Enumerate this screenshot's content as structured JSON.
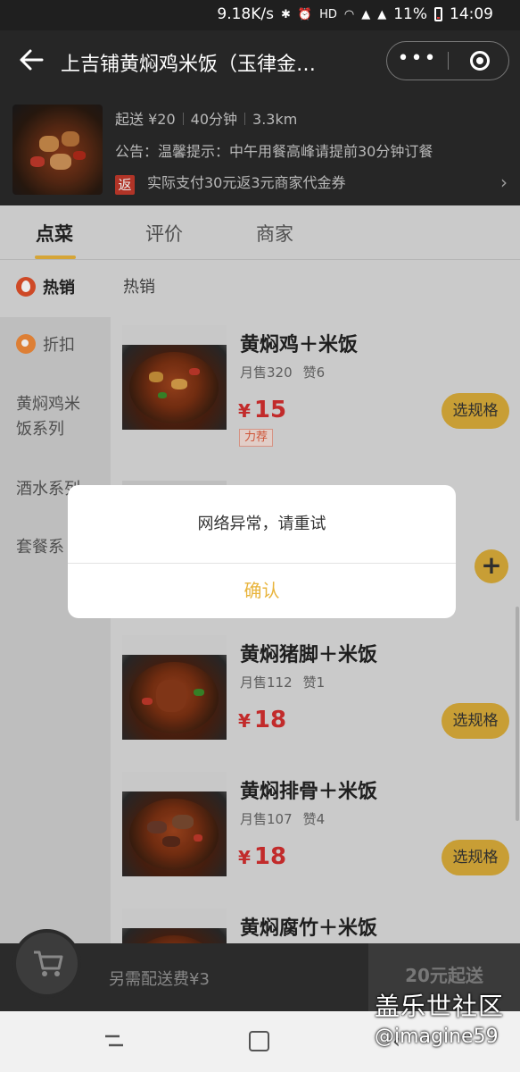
{
  "status_bar": {
    "speed": "9.18K/s",
    "icons": [
      "bluetooth-icon",
      "alarm-icon",
      "hd-icon",
      "wifi-icon",
      "signal-4g-icon",
      "signal-4g-icon",
      "battery-icon"
    ],
    "battery": "11%",
    "time": "14:09",
    "battery_level": 0.11
  },
  "nav": {
    "title": "上吉铺黄焖鸡米饭（玉律金…",
    "more_glyph": "•••"
  },
  "shop": {
    "min_delivery": "起送 ¥20",
    "delivery_time": "40分钟",
    "distance": "3.3km",
    "notice": "公告：温馨提示：中午用餐高峰请提前30分钟订餐",
    "promo_badge": "返",
    "promo_text": "实际支付30元返3元商家代金券",
    "chevron": "›"
  },
  "tabs": [
    {
      "label": "点菜",
      "active": true
    },
    {
      "label": "评价",
      "active": false
    },
    {
      "label": "商家",
      "active": false
    }
  ],
  "sidebar": {
    "items": [
      {
        "label": "热销",
        "icon": "fire-icon",
        "active": true
      },
      {
        "label": "折扣",
        "icon": "discount-tag-icon",
        "active": false
      },
      {
        "label": "黄焖鸡米饭系列",
        "line1": "黄焖鸡米",
        "line2": "饭系列",
        "active": false
      },
      {
        "label": "酒水系列",
        "active": false
      },
      {
        "label": "套餐系",
        "active": false
      }
    ]
  },
  "menu": {
    "section_title": "热销",
    "dishes": [
      {
        "name": "黄焖鸡＋米饭",
        "sales": "月售320",
        "likes": "赞6",
        "currency": "¥",
        "price": "15",
        "tag": "力荐",
        "action": "选规格"
      },
      {
        "name": "黄焖猪脚＋米饭",
        "sales": "月售112",
        "likes": "赞1",
        "currency": "¥",
        "price": "18",
        "action": "选规格"
      },
      {
        "name": "黄焖排骨＋米饭",
        "sales": "月售107",
        "likes": "赞4",
        "currency": "¥",
        "price": "18",
        "action": "选规格"
      },
      {
        "name": "黄焖腐竹＋米饭"
      }
    ],
    "add_glyph": "+"
  },
  "dialog": {
    "message": "网络异常，请重试",
    "confirm": "确认"
  },
  "cart": {
    "delivery_fee": "另需配送费¥3",
    "min_order": "20元起送"
  },
  "watermark": {
    "line1": "盖乐世社区",
    "line2": "@imagine59"
  },
  "colors": {
    "accent": "#e8b43c",
    "price": "#d32f2f",
    "header_bg": "#262626"
  }
}
